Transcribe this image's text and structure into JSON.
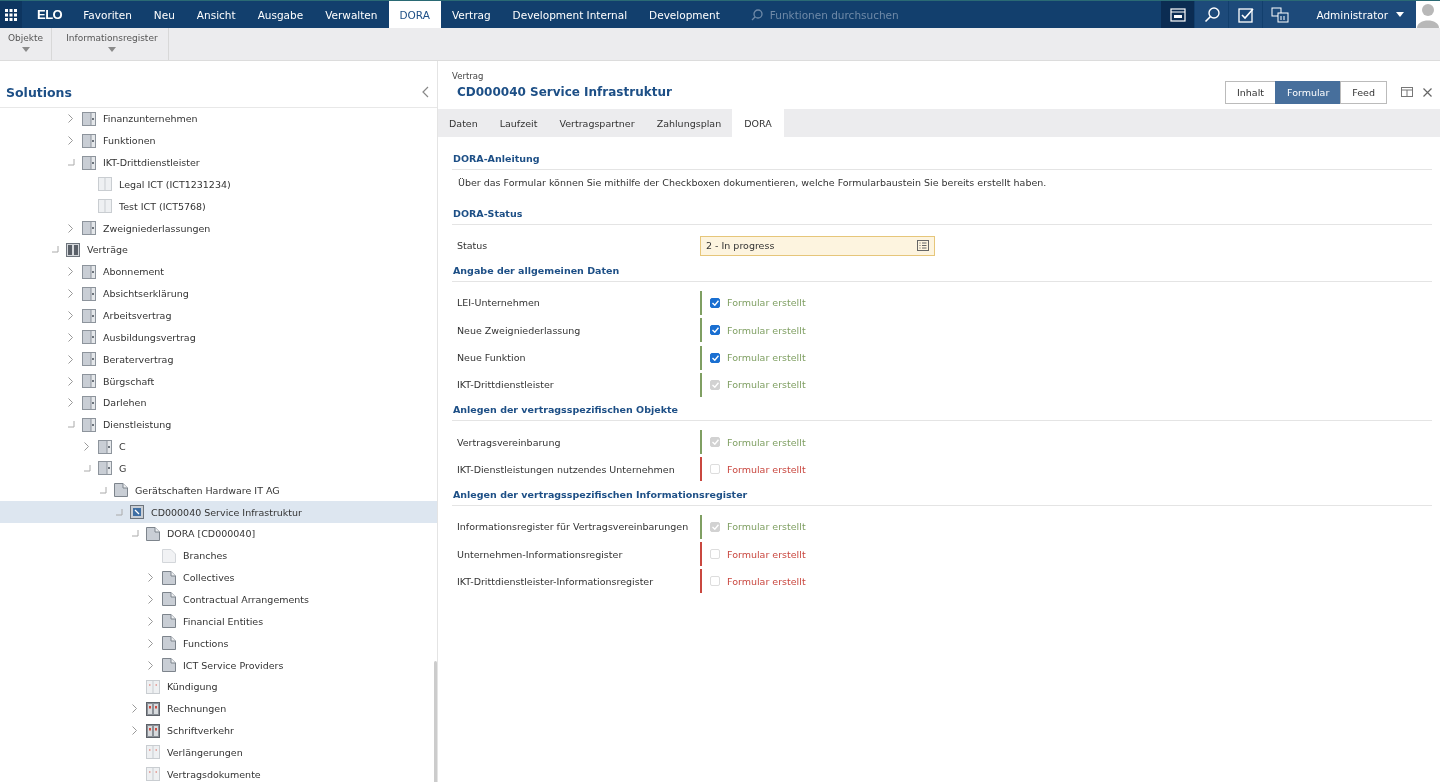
{
  "topbar": {
    "logo": "ELO",
    "menu": [
      {
        "label": "Favoriten",
        "selected": false
      },
      {
        "label": "Neu",
        "selected": false
      },
      {
        "label": "Ansicht",
        "selected": false
      },
      {
        "label": "Ausgabe",
        "selected": false
      },
      {
        "label": "Verwalten",
        "selected": false
      },
      {
        "label": "DORA",
        "selected": true
      },
      {
        "label": "Vertrag",
        "selected": false
      },
      {
        "label": "Development Internal",
        "selected": false
      },
      {
        "label": "Development",
        "selected": false
      }
    ],
    "search": {
      "placeholder": "Funktionen durchsuchen"
    },
    "user": "Administrator"
  },
  "ribbon": [
    "Objekte",
    "Informationsregister"
  ],
  "sidebar": {
    "title": "Solutions",
    "tree": [
      {
        "children": [
          {
            "label": "Finanzunternehmen",
            "kind": "folder",
            "expanded": false
          },
          {
            "label": "Funktionen",
            "kind": "folder",
            "expanded": false
          },
          {
            "label": "IKT-Drittdienstleister",
            "kind": "folder",
            "expanded": true,
            "children": [
              {
                "label": "Legal ICT (ICT1231234)",
                "kind": "empty"
              },
              {
                "label": "Test ICT (ICT5768)",
                "kind": "empty"
              }
            ]
          },
          {
            "label": "Zweigniederlassungen",
            "kind": "folder",
            "expanded": false
          }
        ]
      },
      {
        "label": "Verträge",
        "kind": "cabinet",
        "expanded": true,
        "children": [
          {
            "label": "Abonnement",
            "kind": "folder",
            "expanded": false
          },
          {
            "label": "Absichtserklärung",
            "kind": "folder",
            "expanded": false
          },
          {
            "label": "Arbeitsvertrag",
            "kind": "folder",
            "expanded": false
          },
          {
            "label": "Ausbildungsvertrag",
            "kind": "folder",
            "expanded": false
          },
          {
            "label": "Beratervertrag",
            "kind": "folder",
            "expanded": false
          },
          {
            "label": "Bürgschaft",
            "kind": "folder",
            "expanded": false
          },
          {
            "label": "Darlehen",
            "kind": "folder",
            "expanded": false
          },
          {
            "label": "Dienstleistung",
            "kind": "folder",
            "expanded": true,
            "children": [
              {
                "label": "C",
                "kind": "folder",
                "expanded": false
              },
              {
                "label": "G",
                "kind": "folder",
                "expanded": true,
                "children": [
                  {
                    "label": "Gerätschaften Hardware IT AG",
                    "kind": "page",
                    "expanded": true,
                    "children": [
                      {
                        "label": "CD000040 Service Infrastruktur",
                        "kind": "contract",
                        "expanded": true,
                        "selected": true,
                        "children": [
                          {
                            "label": "DORA [CD000040]",
                            "kind": "page",
                            "expanded": true,
                            "children": [
                              {
                                "label": "Branches",
                                "kind": "emptypage"
                              },
                              {
                                "label": "Collectives",
                                "kind": "page",
                                "expanded": false
                              },
                              {
                                "label": "Contractual Arrangements",
                                "kind": "page",
                                "expanded": false
                              },
                              {
                                "label": "Financial Entities",
                                "kind": "page",
                                "expanded": false
                              },
                              {
                                "label": "Functions",
                                "kind": "page",
                                "expanded": false
                              },
                              {
                                "label": "ICT Service Providers",
                                "kind": "page",
                                "expanded": false
                              }
                            ]
                          },
                          {
                            "label": "Kündigung",
                            "kind": "emptybox"
                          },
                          {
                            "label": "Rechnungen",
                            "kind": "box",
                            "expanded": false
                          },
                          {
                            "label": "Schriftverkehr",
                            "kind": "box",
                            "expanded": false
                          },
                          {
                            "label": "Verlängerungen",
                            "kind": "emptybox"
                          },
                          {
                            "label": "Vertragsdokumente",
                            "kind": "emptybox"
                          }
                        ]
                      }
                    ]
                  }
                ]
              }
            ]
          }
        ]
      }
    ]
  },
  "document": {
    "type": "Vertrag",
    "title": "CD000040 Service Infrastruktur",
    "views": [
      {
        "label": "Inhalt",
        "selected": false
      },
      {
        "label": "Formular",
        "selected": true
      },
      {
        "label": "Feed",
        "selected": false
      }
    ],
    "tabs": [
      {
        "label": "Daten",
        "selected": false
      },
      {
        "label": "Laufzeit",
        "selected": false
      },
      {
        "label": "Vertragspartner",
        "selected": false
      },
      {
        "label": "Zahlungsplan",
        "selected": false
      },
      {
        "label": "DORA",
        "selected": true
      }
    ],
    "sections": [
      {
        "heading": "DORA-Anleitung",
        "text": "Über das Formular können Sie mithilfe der Checkboxen dokumentieren, welche Formularbaustein Sie bereits erstellt haben."
      },
      {
        "heading": "DORA-Status",
        "fields": [
          {
            "kind": "select",
            "label": "Status",
            "value": "2 - In progress"
          }
        ]
      },
      {
        "heading": "Angabe der allgemeinen Daten",
        "fields": [
          {
            "kind": "checkbox",
            "label": "LEI-Unternehmen",
            "checked": true,
            "disabled": false,
            "color": "#7f9f62",
            "text": "Formular erstellt"
          },
          {
            "kind": "checkbox",
            "label": "Neue Zweigniederlassung",
            "checked": true,
            "disabled": false,
            "color": "#7f9f62",
            "text": "Formular erstellt"
          },
          {
            "kind": "checkbox",
            "label": "Neue Funktion",
            "checked": true,
            "disabled": false,
            "color": "#7f9f62",
            "text": "Formular erstellt"
          },
          {
            "kind": "checkbox",
            "label": "IKT-Drittdienstleister",
            "checked": true,
            "disabled": true,
            "color": "#7f9f62",
            "text": "Formular erstellt"
          }
        ]
      },
      {
        "heading": "Anlegen der vertragsspezifischen Objekte",
        "fields": [
          {
            "kind": "checkbox",
            "label": "Vertragsvereinbarung",
            "checked": true,
            "disabled": true,
            "color": "#7f9f62",
            "text": "Formular erstellt"
          },
          {
            "kind": "checkbox",
            "label": "IKT-Dienstleistungen nutzendes Unternehmen",
            "checked": false,
            "disabled": true,
            "color": "#c9473f",
            "text": "Formular erstellt"
          }
        ]
      },
      {
        "heading": "Anlegen der vertragsspezifischen Informationsregister",
        "fields": [
          {
            "kind": "checkbox",
            "label": "Informationsregister für Vertragsvereinbarungen",
            "checked": true,
            "disabled": true,
            "color": "#7f9f62",
            "text": "Formular erstellt"
          },
          {
            "kind": "checkbox",
            "label": "Unternehmen-Informationsregister",
            "checked": false,
            "disabled": true,
            "color": "#c9473f",
            "text": "Formular erstellt"
          },
          {
            "kind": "checkbox",
            "label": "IKT-Drittdienstleister-Informationsregister",
            "checked": false,
            "disabled": true,
            "color": "#c9473f",
            "text": "Formular erstellt"
          }
        ]
      }
    ]
  }
}
